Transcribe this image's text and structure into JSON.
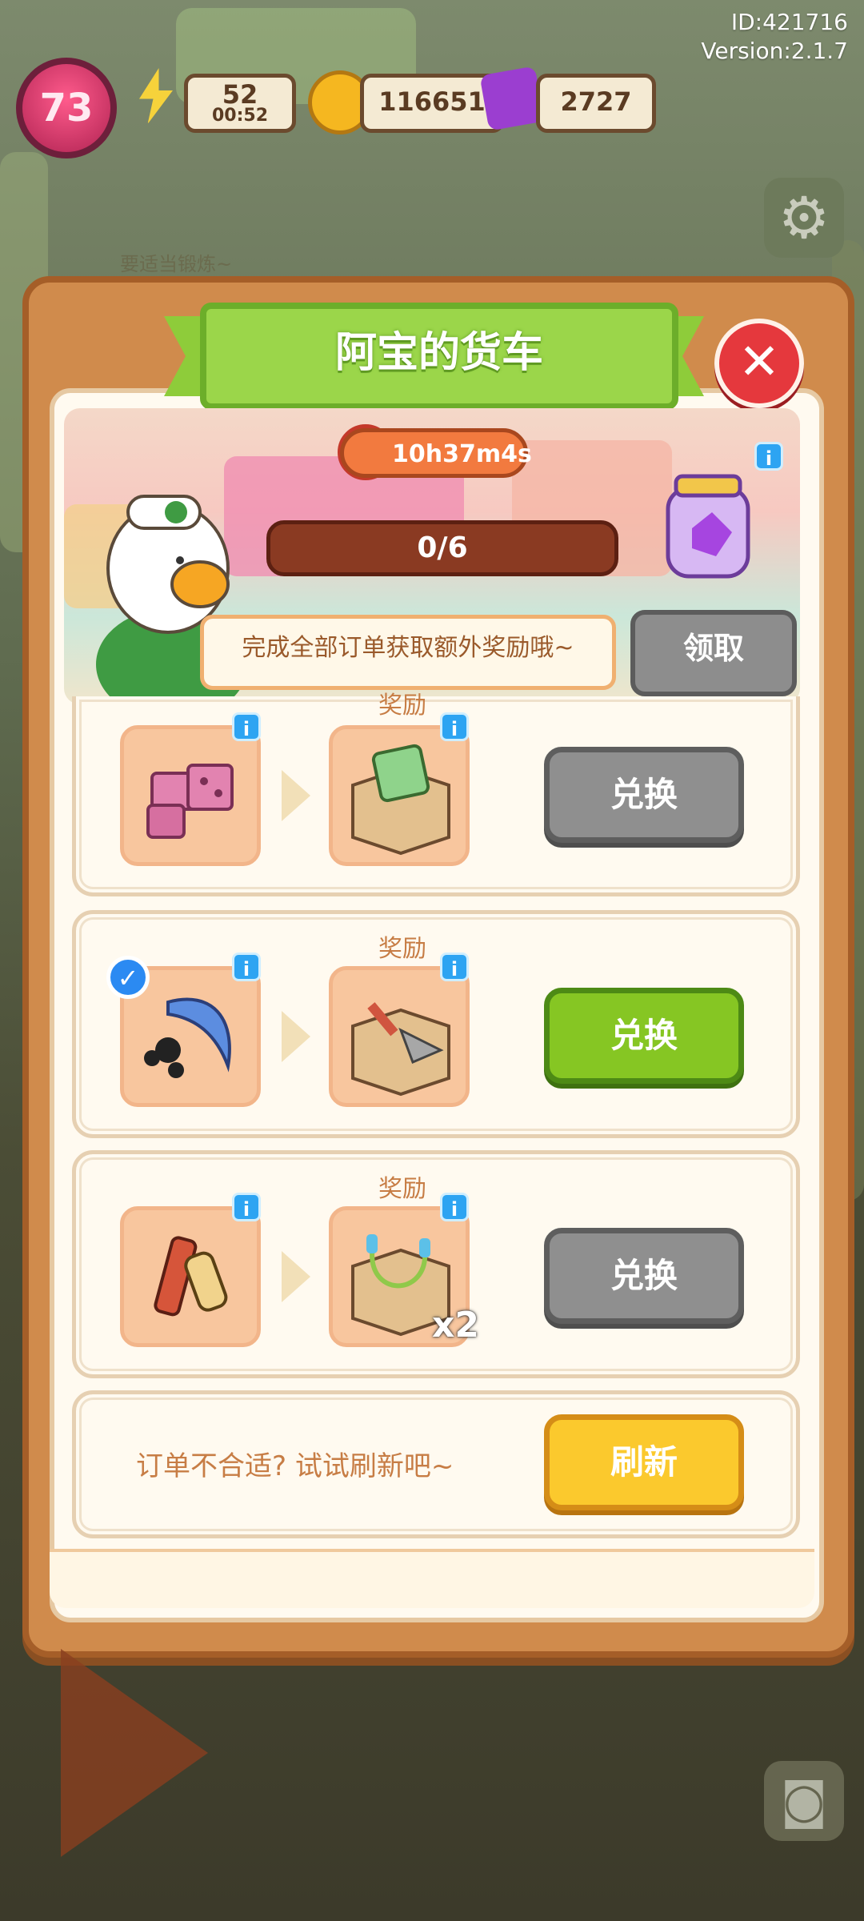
{
  "hud": {
    "player_id": "ID:421716",
    "version": "Version:2.1.7",
    "level": "73",
    "energy": "52",
    "energy_timer": "00:52",
    "coins": "116651",
    "gems": "2727",
    "background_hint": "要适当锻炼~"
  },
  "modal": {
    "title": "阿宝的货车",
    "close_symbol": "✕",
    "timer": "10h37m4s",
    "progress_text": "0/6",
    "progress_fraction": 0,
    "speech": "完成全部订单获取额外奖励哦~",
    "claim_label": "领取",
    "info_symbol": "i"
  },
  "orders": [
    {
      "reward_label": "奖励",
      "item_icon": "pink-bricks-icon",
      "reward_icon": "chick-card-box-icon",
      "button_label": "兑换",
      "button_state": "disabled",
      "quantity": ""
    },
    {
      "reward_label": "奖励",
      "item_icon": "blue-pickaxe-icon",
      "reward_icon": "trowel-box-icon",
      "button_label": "兑换",
      "button_state": "active",
      "quantity": "",
      "completed_mark": "✓"
    },
    {
      "reward_label": "奖励",
      "item_icon": "keys-icon",
      "reward_icon": "jump-rope-box-icon",
      "button_label": "兑换",
      "button_state": "disabled",
      "quantity": "x2"
    }
  ],
  "refresh": {
    "text": "订单不合适? 试试刷新吧~",
    "button_label": "刷新"
  },
  "colors": {
    "modal_frame": "#d08b4c",
    "ribbon_green": "#9bd64a",
    "close_red": "#e5383d",
    "button_green": "#86c623",
    "button_gray": "#8f8f8f",
    "button_yellow": "#fbc92d",
    "info_blue": "#2da4f2"
  }
}
